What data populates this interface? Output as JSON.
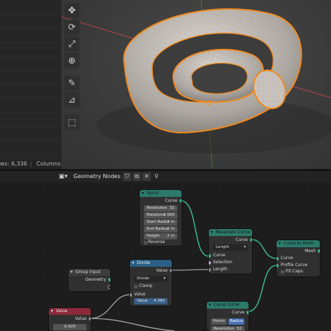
{
  "spreadsheet": {
    "rows_label": "ws: 6,336",
    "columns_label": "Columns: 1"
  },
  "node_editor": {
    "title": "Geometry Nodes"
  },
  "nodes": {
    "spiral": {
      "title": "Spiral",
      "output": "Curve",
      "fields": [
        {
          "label": "Resolution",
          "value": "32"
        },
        {
          "label": "Rotations",
          "value": "2.000"
        },
        {
          "label": "Start Radiu",
          "value": "3 m"
        },
        {
          "label": "End Radius",
          "value": "2 m"
        },
        {
          "label": "Height",
          "value": "2 m"
        }
      ],
      "reverse": "Reverse"
    },
    "resample": {
      "title": "Resample Curve",
      "output": "Curve",
      "mode": "Length",
      "inputs": [
        "Curve",
        "Selection",
        "Length"
      ]
    },
    "curve_to_mesh": {
      "title": "Curve to Mesh",
      "output": "Mesh",
      "inputs": [
        "Curve",
        "Profile Curve",
        "Fill Caps"
      ]
    },
    "group_input": {
      "title": "Group Input",
      "output": "Geometry"
    },
    "divide": {
      "title": "Divide",
      "output": "Value",
      "operation": "Divide",
      "clamp": "Clamp",
      "input": "Value",
      "field_label": "Value",
      "field_value": "4.380"
    },
    "value": {
      "title": "Value",
      "output": "Value",
      "field_value": "0.420"
    },
    "curve_circle": {
      "title": "Curve Circle",
      "output": "Curve",
      "mode_points": "Points",
      "mode_radius": "Radius",
      "resolution_label": "Resolution",
      "resolution_value": "32"
    }
  },
  "colors": {
    "selection_orange": "#f08a1f",
    "node_green": "#2b7a6a",
    "node_blue": "#2a5f86",
    "node_red": "#8a2a3a",
    "socket_green": "#3fb98a"
  }
}
